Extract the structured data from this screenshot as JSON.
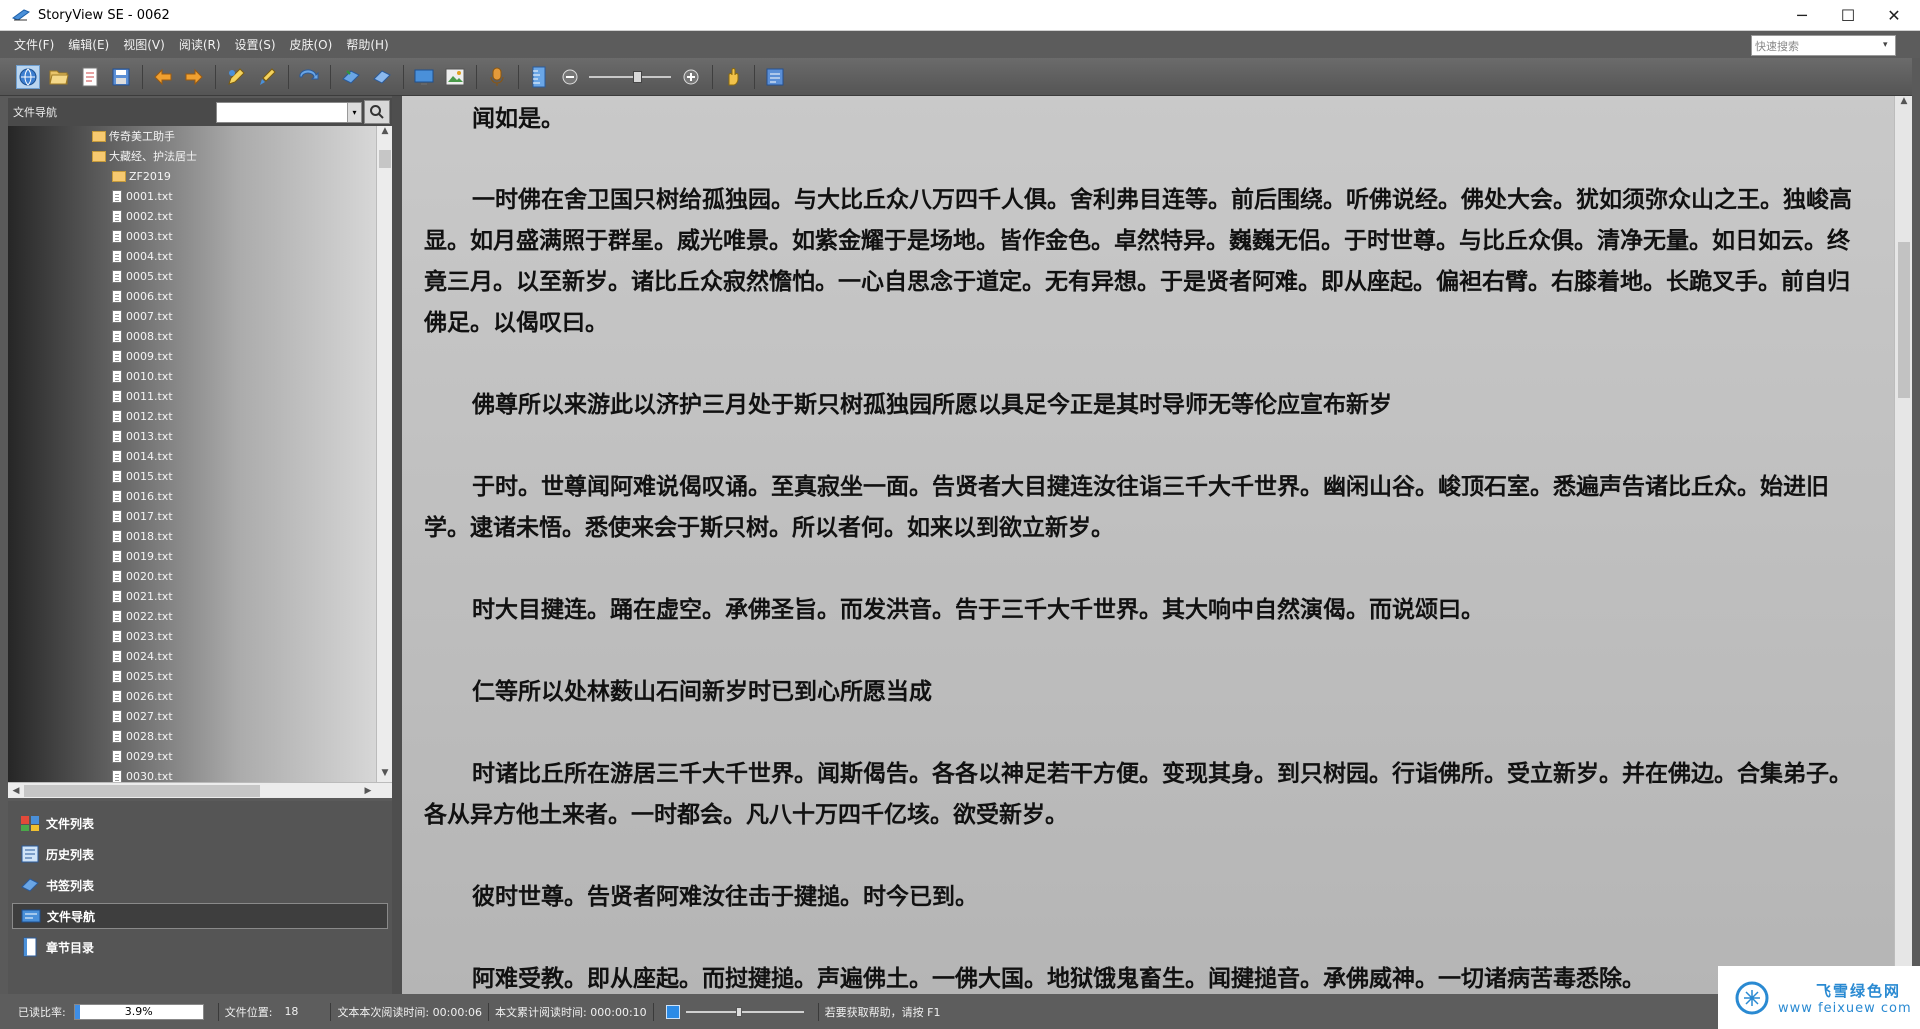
{
  "window": {
    "title": "StoryView SE - 0062",
    "controls": {
      "minimize": "─",
      "maximize": "☐",
      "close": "✕"
    }
  },
  "menu": {
    "items": [
      "文件(F)",
      "编辑(E)",
      "视图(V)",
      "阅读(R)",
      "设置(S)",
      "皮肤(O)",
      "帮助(H)"
    ],
    "quick_search_placeholder": "快速搜索"
  },
  "toolbar": {
    "zoom_slider_level": 0.6
  },
  "nav": {
    "title": "文件导航",
    "tree": {
      "folders": [
        "传奇美工助手",
        "大藏经、护法居士",
        "ZF2019"
      ],
      "files": [
        "0001.txt",
        "0002.txt",
        "0003.txt",
        "0004.txt",
        "0005.txt",
        "0006.txt",
        "0007.txt",
        "0008.txt",
        "0009.txt",
        "0010.txt",
        "0011.txt",
        "0012.txt",
        "0013.txt",
        "0014.txt",
        "0015.txt",
        "0016.txt",
        "0017.txt",
        "0018.txt",
        "0019.txt",
        "0020.txt",
        "0021.txt",
        "0022.txt",
        "0023.txt",
        "0024.txt",
        "0025.txt",
        "0026.txt",
        "0027.txt",
        "0028.txt",
        "0029.txt",
        "0030.txt"
      ]
    },
    "panels": [
      {
        "label": "文件列表",
        "icon": "file-list-icon"
      },
      {
        "label": "历史列表",
        "icon": "history-icon"
      },
      {
        "label": "书签列表",
        "icon": "bookmark-icon"
      },
      {
        "label": "文件导航",
        "icon": "file-nav-icon",
        "active": true
      },
      {
        "label": "章节目录",
        "icon": "chapter-icon"
      }
    ]
  },
  "reader": {
    "paragraphs": [
      "闻如是。",
      "一时佛在舍卫国只树给孤独园。与大比丘众八万四千人俱。舍利弗目连等。前后围绕。听佛说经。佛处大会。犹如须弥众山之王。独峻高显。如月盛满照于群星。威光唯景。如紫金耀于是场地。皆作金色。卓然特异。巍巍无侣。于时世尊。与比丘众俱。清净无量。如日如云。终竟三月。以至新岁。诸比丘众寂然憺怕。一心自思念于道定。无有异想。于是贤者阿难。即从座起。偏袒右臂。右膝着地。长跪叉手。前自归佛足。以偈叹曰。",
      "佛尊所以来游此以济护三月处于斯只树孤独园所愿以具足今正是其时导师无等伦应宣布新岁",
      "于时。世尊闻阿难说偈叹诵。至真寂坐一面。告贤者大目揵连汝往诣三千大千世界。幽闲山谷。峻顶石室。悉遍声告诸比丘众。始进旧学。逮诸未悟。悉使来会于斯只树。所以者何。如来以到欲立新岁。",
      "时大目揵连。踊在虚空。承佛圣旨。而发洪音。告于三千大千世界。其大响中自然演偈。而说颂曰。",
      "仁等所以处林薮山石间新岁时已到心所愿当成",
      "时诸比丘所在游居三千大千世界。闻斯偈告。各各以神足若干方便。变现其身。到只树园。行诣佛所。受立新岁。并在佛边。合集弟子。各从异方他土来者。一时都会。凡八十万四千亿垓。欲受新岁。",
      "彼时世尊。告贤者阿难汝往击于揵搥。时今已到。",
      "阿难受教。即从座起。而挝揵搥。声遍佛土。一佛大国。地狱饿鬼畜生。闻揵搥音。承佛威神。一切诸病苦毒悉除。"
    ]
  },
  "status": {
    "read_ratio_label": "已读比率:",
    "read_ratio_value": "3.9%",
    "read_ratio_fraction": 0.039,
    "file_pos_label": "文件位置:",
    "file_pos_value": "18",
    "session_time": "文本本次阅读时间: 00:00:06",
    "total_time": "本文累计阅读时间: 000:00:10",
    "speed_level": 0.45,
    "help_text": "若要获取帮助，请按 F1"
  },
  "watermark": {
    "cn": "飞雪绿色网",
    "en": "www  feixuew  com"
  },
  "colors": {
    "accent_blue": "#2a8ad2",
    "folder": "#f6c970"
  }
}
